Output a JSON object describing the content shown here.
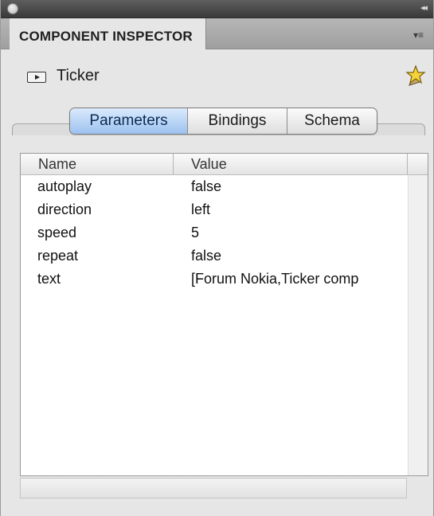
{
  "panel": {
    "title": "COMPONENT INSPECTOR",
    "collapse_glyph": "◂◂",
    "menu_glyph": "▾≡"
  },
  "component": {
    "name": "Ticker",
    "icon": "movieclip-icon",
    "badge_icon": "star-icon"
  },
  "tabs": [
    {
      "label": "Parameters",
      "active": true
    },
    {
      "label": "Bindings",
      "active": false
    },
    {
      "label": "Schema",
      "active": false
    }
  ],
  "table": {
    "columns": [
      "Name",
      "Value"
    ],
    "rows": [
      {
        "name": "autoplay",
        "value": "false"
      },
      {
        "name": "direction",
        "value": "left"
      },
      {
        "name": "speed",
        "value": "5"
      },
      {
        "name": "repeat",
        "value": "false"
      },
      {
        "name": "text",
        "value": "[Forum Nokia,Ticker comp"
      }
    ]
  },
  "colors": {
    "active_tab": "#9cc2ef",
    "panel_bg": "#e6e6e6"
  }
}
